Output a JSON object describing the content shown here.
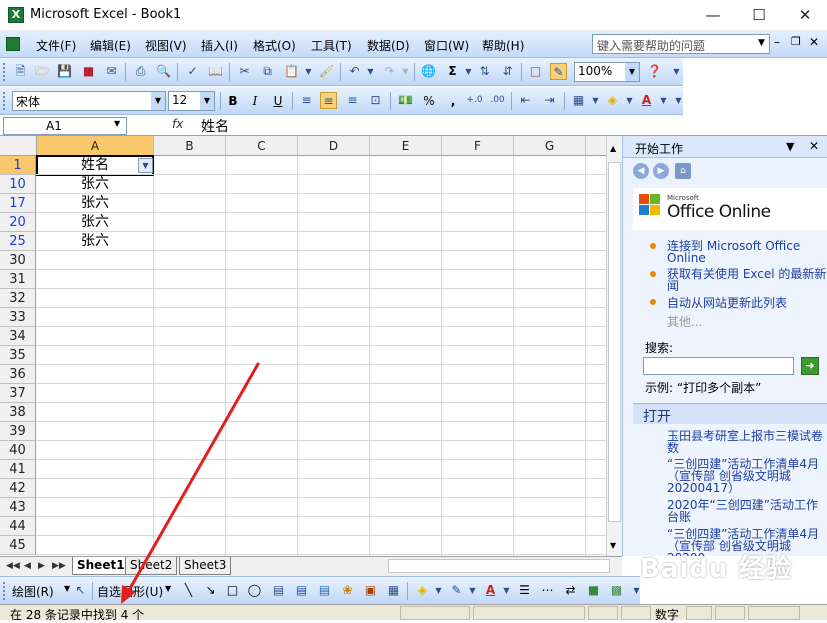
{
  "window": {
    "title": "Microsoft Excel - Book1",
    "app_icon": "excel-icon",
    "buttons": [
      "minimize",
      "maximize",
      "close"
    ]
  },
  "menubar": {
    "items": [
      "文件(F)",
      "编辑(E)",
      "视图(V)",
      "插入(I)",
      "格式(O)",
      "工具(T)",
      "数据(D)",
      "窗口(W)",
      "帮助(H)"
    ],
    "help_placeholder": "键入需要帮助的问题"
  },
  "toolbar_standard": {
    "zoom": "100%"
  },
  "toolbar_format": {
    "font": "宋体",
    "size": "12",
    "bold": "B",
    "italic": "I",
    "underline": "U",
    "percent": "%",
    "comma": ","
  },
  "formula_bar": {
    "name_box": "A1",
    "fx": "fx",
    "value": "姓名"
  },
  "grid": {
    "columns": [
      "A",
      "B",
      "C",
      "D",
      "E",
      "F",
      "G"
    ],
    "rows": [
      "1",
      "10",
      "17",
      "20",
      "25",
      "30",
      "31",
      "32",
      "33",
      "34",
      "35",
      "36",
      "37",
      "38",
      "39",
      "40",
      "41",
      "42",
      "43",
      "44",
      "45"
    ],
    "cells_a": [
      "姓名",
      "张六",
      "张六",
      "张六",
      "张六"
    ]
  },
  "sheets": [
    "Sheet1",
    "Sheet2",
    "Sheet3"
  ],
  "task_pane": {
    "title": "开始工作",
    "logo_small": "Microsoft",
    "logo_big": "Office Online",
    "links": [
      "连接到 Microsoft Office Online",
      "获取有关使用 Excel 的最新新闻",
      "自动从网站更新此列表"
    ],
    "more": "其他...",
    "search_label": "搜索:",
    "example_label": "示例:",
    "example_value": "“打印多个副本”",
    "open_section": "打开",
    "files": [
      "玉田县考研室上报市三模试卷数",
      "“三创四建”活动工作清单4月（宣传部 创省级文明城20200417）",
      "2020年“三创四建”活动工作台账",
      "“三创四建”活动工作清单4月（宣传部 创省级文明城20200..."
    ]
  },
  "drawing_toolbar": {
    "draw_label": "绘图(R)",
    "autoshape_label": "自选图形(U)"
  },
  "statusbar": {
    "message": "在 28 条记录中找到 4 个",
    "mode": "数字"
  },
  "watermark": "Baidu 经验",
  "colors": {
    "arrow": "#e0201a",
    "selected_header": "#f9c86a",
    "row_blue": "#1a3fd0"
  }
}
